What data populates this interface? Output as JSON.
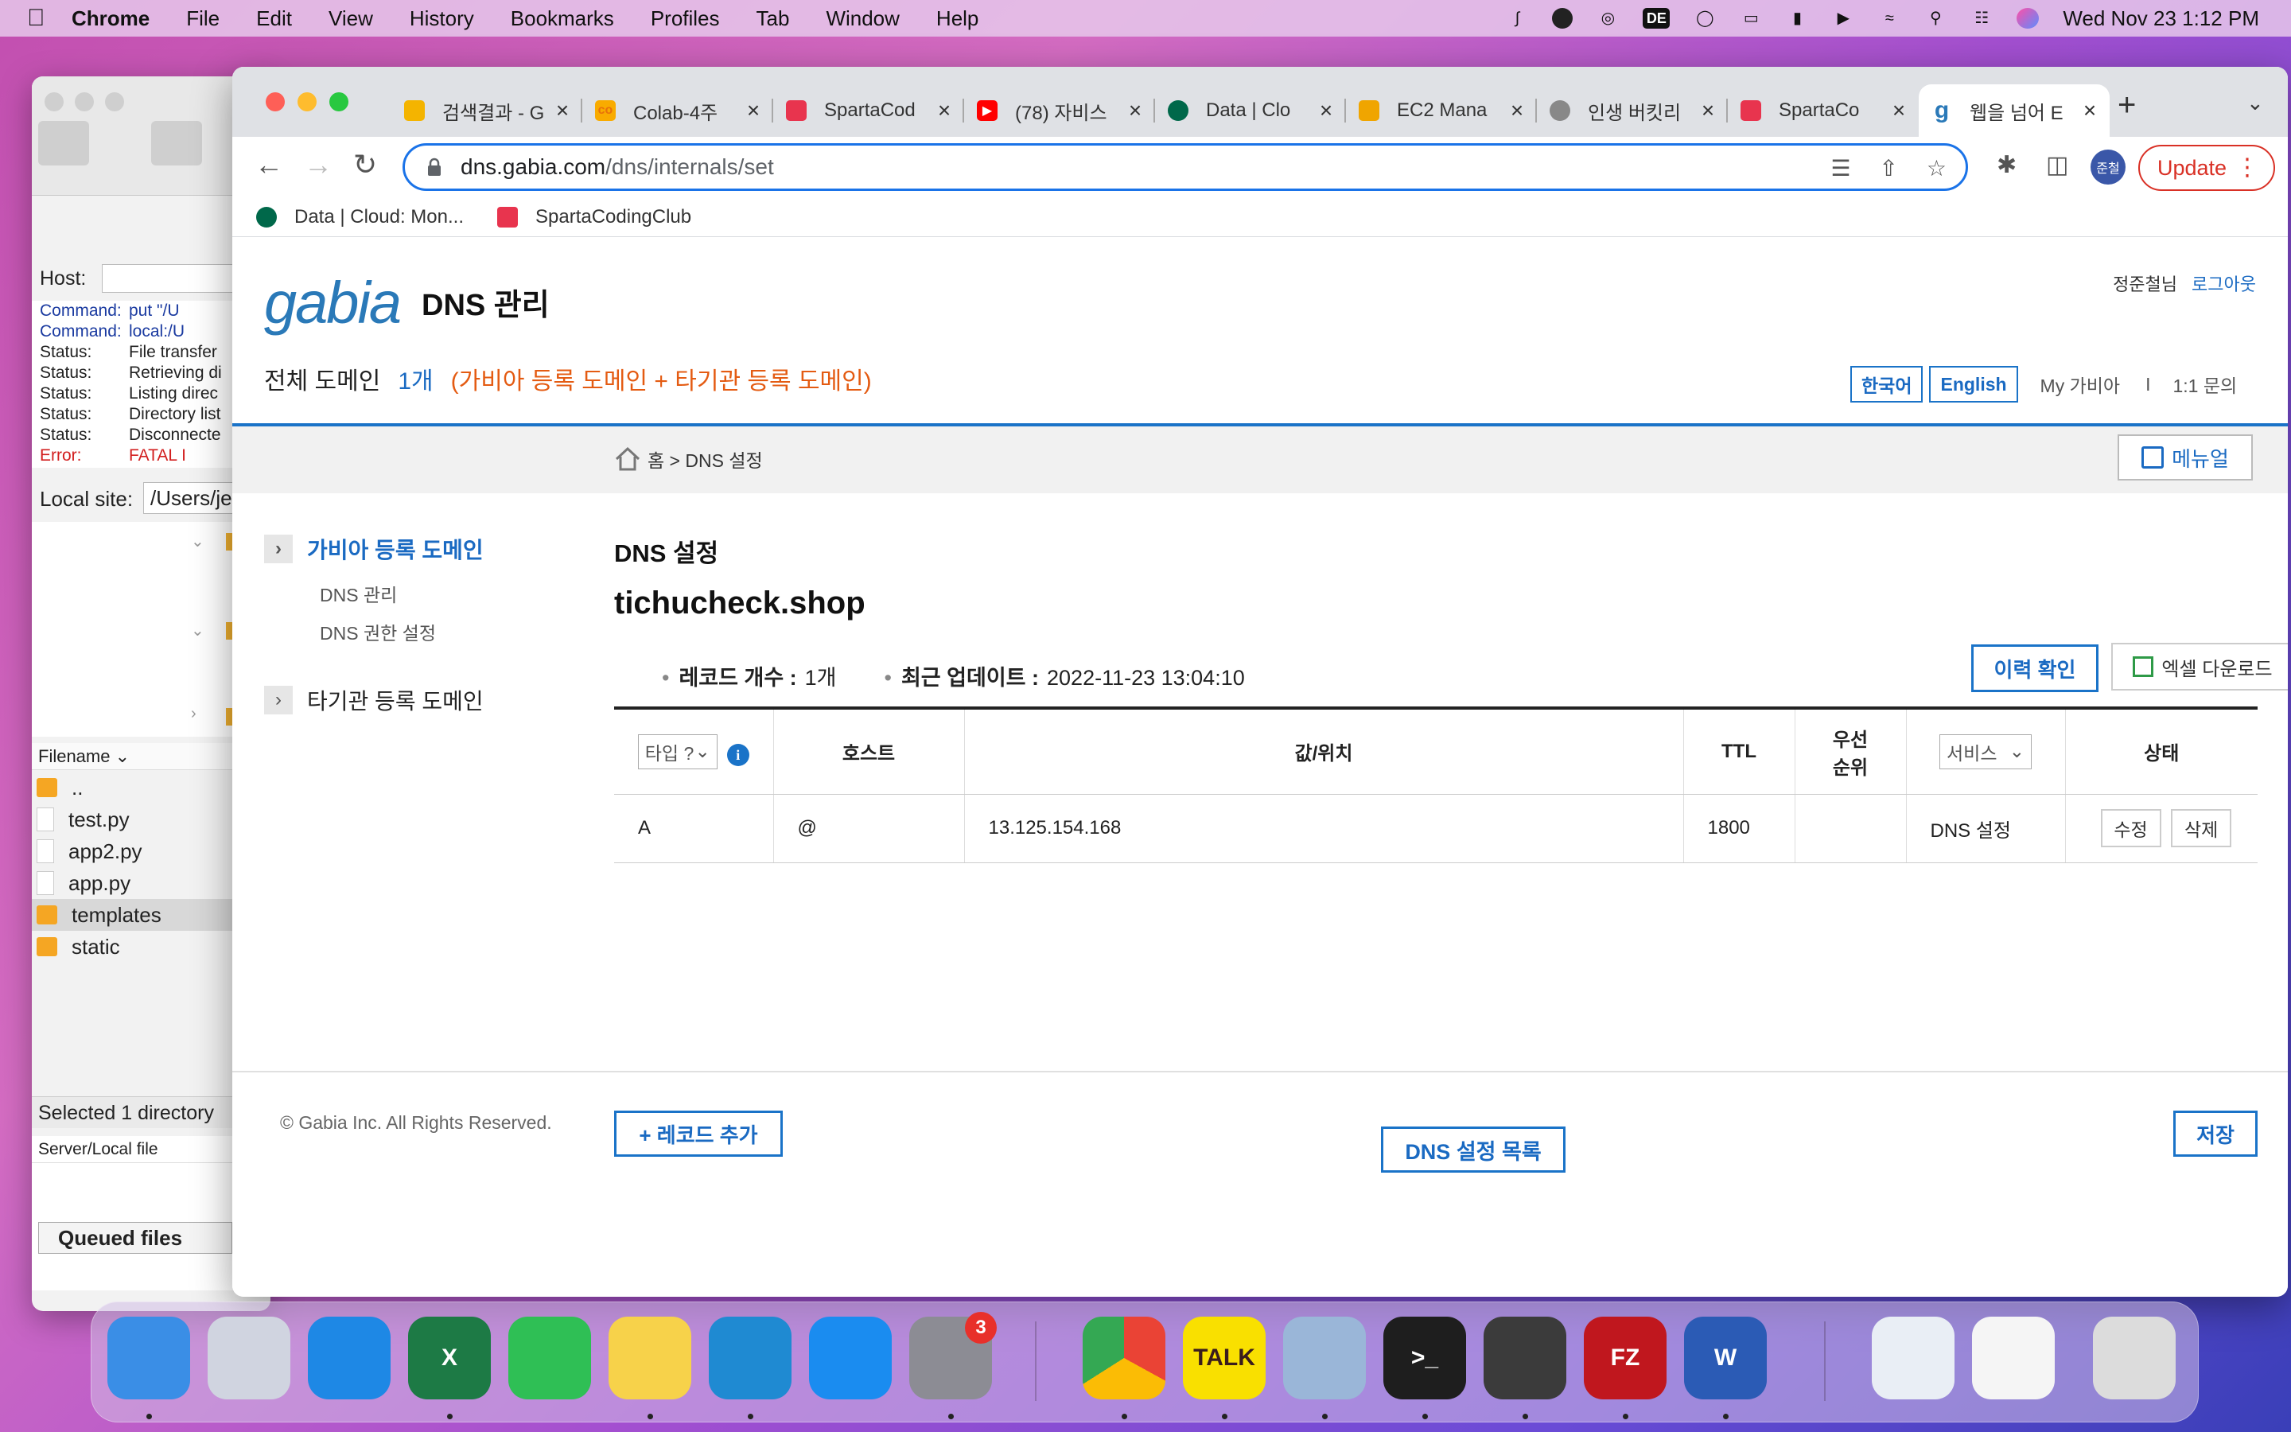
{
  "menubar": {
    "app_name": "Chrome",
    "items": [
      "File",
      "Edit",
      "View",
      "History",
      "Bookmarks",
      "Profiles",
      "Tab",
      "Window",
      "Help"
    ],
    "de_label": "DE",
    "clock": "Wed Nov 23  1:12 PM"
  },
  "filezilla": {
    "host_label": "Host:",
    "log": [
      {
        "k": "Command:",
        "v": "put \"/U",
        "type": "cmd"
      },
      {
        "k": "Command:",
        "v": "local:/U",
        "type": "cmd"
      },
      {
        "k": "Status:",
        "v": "File transfer",
        "type": "status"
      },
      {
        "k": "Status:",
        "v": "Retrieving di",
        "type": "status"
      },
      {
        "k": "Status:",
        "v": "Listing direc",
        "type": "status"
      },
      {
        "k": "Status:",
        "v": "Directory list",
        "type": "status"
      },
      {
        "k": "Status:",
        "v": "Disconnecte",
        "type": "status"
      },
      {
        "k": "Error:",
        "v": "FATAL I",
        "type": "err"
      }
    ],
    "local_site_label": "Local site:",
    "local_site_value": "/Users/je",
    "filename_header": "Filename",
    "files": [
      {
        "name": "..",
        "kind": "folder"
      },
      {
        "name": "test.py",
        "kind": "doc"
      },
      {
        "name": "app2.py",
        "kind": "doc"
      },
      {
        "name": "app.py",
        "kind": "doc"
      },
      {
        "name": "templates",
        "kind": "folder",
        "selected": true
      },
      {
        "name": "static",
        "kind": "folder"
      }
    ],
    "status_text": "Selected 1 directory",
    "queue_header": "Server/Local file",
    "queued_tab": "Queued files"
  },
  "chrome": {
    "tabs": [
      {
        "title": "검색결과 - G",
        "favicon": "gdrive-icon",
        "color": "#f4b400"
      },
      {
        "title": "Colab-4주",
        "favicon": "colab-icon",
        "color": "#f9ab00"
      },
      {
        "title": "SpartaCod",
        "favicon": "sparta-icon",
        "color": "#e8344e"
      },
      {
        "title": "(78) 자비스",
        "favicon": "youtube-icon",
        "color": "#ff0000"
      },
      {
        "title": "Data | Clo",
        "favicon": "mongodb-icon",
        "color": "#00684a"
      },
      {
        "title": "EC2 Mana",
        "favicon": "aws-icon",
        "color": "#f0a500"
      },
      {
        "title": "인생 버킷리",
        "favicon": "globe-icon",
        "color": "#888888"
      },
      {
        "title": "SpartaCo",
        "favicon": "sparta-icon",
        "color": "#e8344e"
      },
      {
        "title": "웹을 넘어 E",
        "favicon": "gabia-icon",
        "color": "#2a79b8",
        "active": true
      }
    ],
    "url_host": "dns.gabia.com",
    "url_path": "/dns/internals/set",
    "profile_label": "준철",
    "update_label": "Update",
    "bookmarks": [
      {
        "label": "Data | Cloud: Mon...",
        "icon": "mongodb-icon",
        "color": "#00684a"
      },
      {
        "label": "SpartaCodingClub",
        "icon": "sparta-icon",
        "color": "#e8344e"
      }
    ]
  },
  "gabia": {
    "logo": "gabia",
    "header_title": "DNS 관리",
    "user_name": "정준철님",
    "logout": "로그아웃",
    "domain_total_label": "전체 도메인",
    "domain_count": "1개",
    "domain_desc": "(가비아 등록 도메인 + 타기관 등록 도메인)",
    "lang_ko": "한국어",
    "lang_en": "English",
    "my_gabia": "My 가비아",
    "separator": "I",
    "inquiry": "1:1 문의",
    "breadcrumb": "홈 > DNS 설정",
    "manual": "메뉴얼",
    "sidebar": {
      "group1": "가비아 등록 도메인",
      "sub1": "DNS 관리",
      "sub2": "DNS 권한 설정",
      "group2": "타기관 등록 도메인"
    },
    "section_title": "DNS 설정",
    "domain_name": "tichucheck.shop",
    "record_count_label": "레코드 개수 :",
    "record_count": "1개",
    "updated_label": "최근 업데이트 :",
    "updated_value": "2022-11-23 13:04:10",
    "history_btn": "이력 확인",
    "excel_btn": "엑셀 다운로드",
    "table": {
      "type_select": "타입 ?",
      "host": "호스트",
      "value": "값/위치",
      "ttl": "TTL",
      "priority_1": "우선",
      "priority_2": "순위",
      "service_select": "서비스",
      "status": "상태",
      "rows": [
        {
          "type": "A",
          "host": "@",
          "value": "13.125.154.168",
          "ttl": "1800",
          "priority": "",
          "service": "DNS 설정",
          "edit": "수정",
          "delete": "삭제"
        }
      ]
    },
    "add_record": "+ 레코드 추가",
    "dns_list": "DNS 설정 목록",
    "save": "저장",
    "footer": "© Gabia Inc. All Rights Reserved."
  },
  "dock": {
    "apps": [
      {
        "name": "finder-icon",
        "color": "#3a8ee6",
        "label": ""
      },
      {
        "name": "launchpad-icon",
        "color": "#d0d4e0",
        "label": ""
      },
      {
        "name": "safari-icon",
        "color": "#1e88e5",
        "label": ""
      },
      {
        "name": "excel-icon",
        "color": "#1d7a45",
        "label": "X"
      },
      {
        "name": "facetime-icon",
        "color": "#2fbf55",
        "label": ""
      },
      {
        "name": "notes-icon",
        "color": "#f7d24a",
        "label": ""
      },
      {
        "name": "vscode-icon",
        "color": "#1f8ad2",
        "label": ""
      },
      {
        "name": "appstore-icon",
        "color": "#1a8cf0",
        "label": ""
      },
      {
        "name": "settings-icon",
        "color": "#8c8c94",
        "label": "",
        "badge": "3"
      },
      {
        "name": "chrome-icon",
        "color": "#e8e8e8",
        "label": ""
      },
      {
        "name": "kakaotalk-icon",
        "color": "#f9e000",
        "label": "TALK"
      },
      {
        "name": "preview-icon",
        "color": "#9ab6d8",
        "label": ""
      },
      {
        "name": "terminal-icon",
        "color": "#1e1e1e",
        "label": ">_"
      },
      {
        "name": "keychain-icon",
        "color": "#3b3b3b",
        "label": ""
      },
      {
        "name": "filezilla-icon",
        "color": "#c0171e",
        "label": "FZ"
      },
      {
        "name": "word-icon",
        "color": "#2b5bb5",
        "label": "W"
      },
      {
        "name": "recent-window-1-icon",
        "color": "#e9eef5",
        "label": ""
      },
      {
        "name": "recent-window-2-icon",
        "color": "#f5f5f5",
        "label": ""
      },
      {
        "name": "trash-icon",
        "color": "#dcdcdc",
        "label": ""
      }
    ]
  }
}
